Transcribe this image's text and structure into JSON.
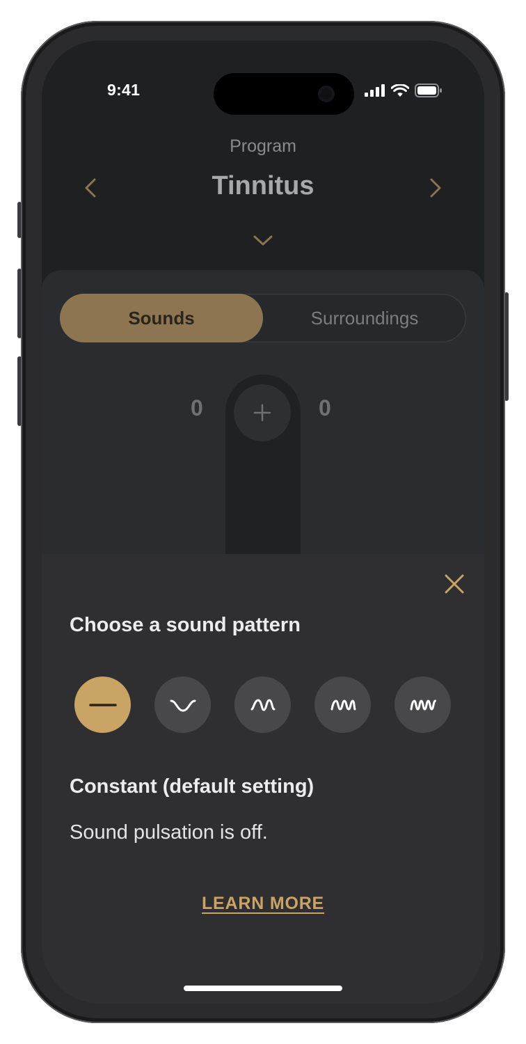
{
  "status_bar": {
    "time": "9:41"
  },
  "header": {
    "label": "Program",
    "title": "Tinnitus"
  },
  "segments": [
    {
      "label": "Sounds",
      "selected": true
    },
    {
      "label": "Surroundings",
      "selected": false
    }
  ],
  "volume": {
    "left_value": "0",
    "right_value": "0"
  },
  "sheet": {
    "title": "Choose a sound pattern",
    "patterns": [
      {
        "icon": "flat-line-icon",
        "selected": true
      },
      {
        "icon": "single-wave-icon",
        "selected": false
      },
      {
        "icon": "double-wave-icon",
        "selected": false
      },
      {
        "icon": "triple-wave-icon",
        "selected": false
      },
      {
        "icon": "quad-wave-icon",
        "selected": false
      }
    ],
    "selected_name": "Constant (default setting)",
    "selected_description": "Sound pulsation is off.",
    "learn_more": "LEARN MORE"
  },
  "colors": {
    "accent": "#c9a464",
    "segment_selected": "#8c7550",
    "background": "#1f2022",
    "sheet": "#2f2f31"
  }
}
